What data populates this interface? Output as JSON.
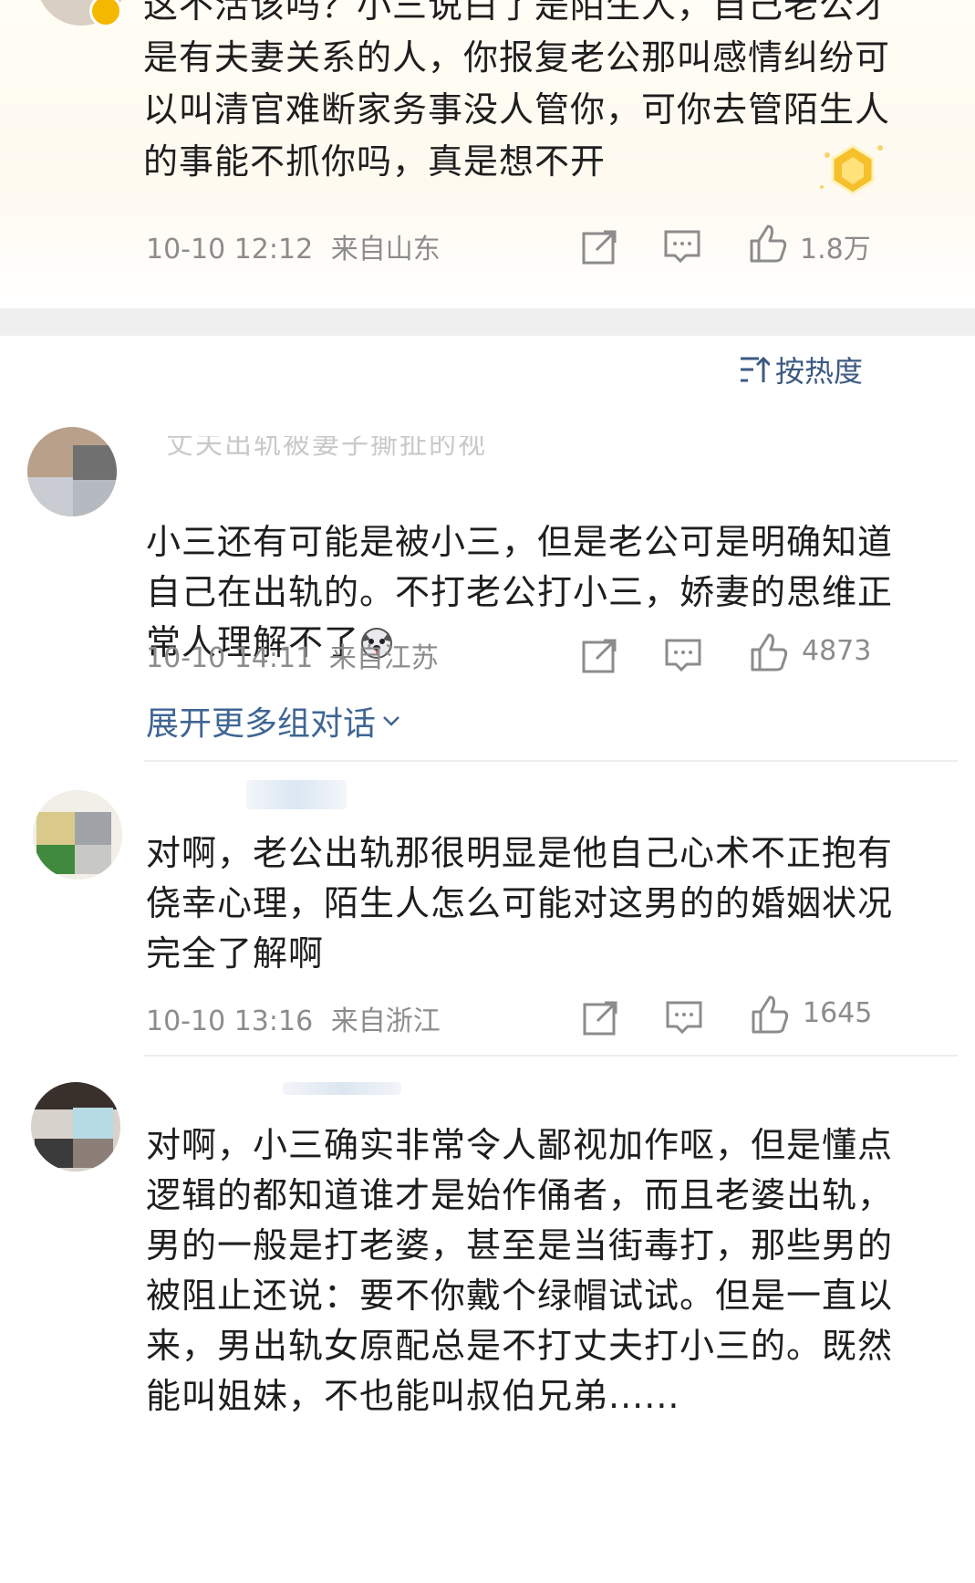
{
  "comments": [
    {
      "text": "这不活该吗？小三说白了是陌生人，自己老公才\n是有夫妻关系的人，你报复老公那叫感情纠纷可\n以叫清官难断家务事没人管你，可你去管陌生人\n的事能不抓你吗，真是想不开",
      "time": "10-10 12:12",
      "location": "来自山东",
      "likes": "1.8万"
    },
    {
      "reply_hint": "丈夫出轨被妻子撕扯的视频",
      "text": "小三还有可能是被小三，但是老公可是明确知道\n自己在出轨的。不打老公打小三，娇妻的思维正\n常人理解不了",
      "time": "10-10 14:11",
      "location": "来自江苏",
      "likes": "4873"
    },
    {
      "text": "对啊，老公出轨那很明显是他自己心术不正抱有\n侥幸心理，陌生人怎么可能对这男的的婚姻状况\n完全了解啊",
      "time": "10-10 13:16",
      "location": "来自浙江",
      "likes": "1645"
    },
    {
      "text": "对啊，小三确实非常令人鄙视加作呕，但是懂点\n逻辑的都知道谁才是始作俑者，而且老婆出轨，\n男的一般是打老婆，甚至是当街毒打，那些男的\n被阻止还说：要不你戴个绿帽试试。但是一直以\n来，男出轨女原配总是不打丈夫打小三的。既然\n能叫姐妹，不也能叫叔伯兄弟......"
    }
  ],
  "sort_label": "按热度",
  "expand_label": "展开更多组对话",
  "colors": {
    "link": "#3f6594",
    "meta": "#8c8c8c",
    "band": "#efefef"
  },
  "icons": [
    "share-icon",
    "comment-icon",
    "like-icon",
    "sort-icon",
    "chevron-down-icon",
    "verified-badge-icon",
    "dog-emoji-icon",
    "gold-badge-icon"
  ]
}
